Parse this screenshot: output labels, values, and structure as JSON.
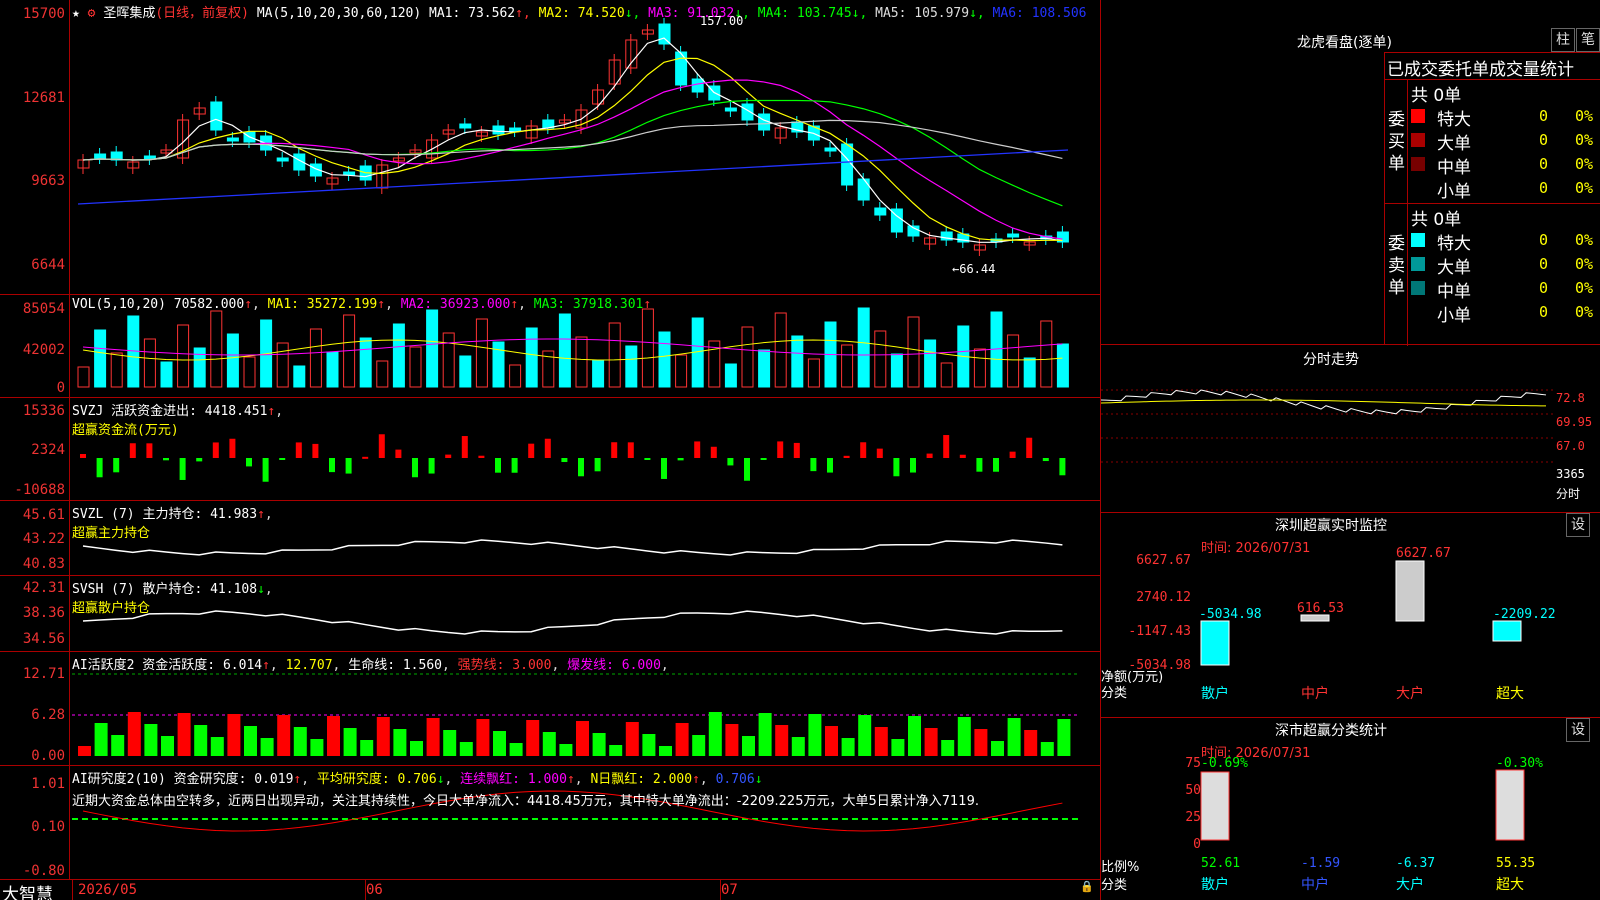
{
  "kline": {
    "stock_name": "圣晖集成",
    "period": "(日线，前复权)",
    "ma_label": "MA(5,10,20,30,60,120)",
    "ma_values": [
      {
        "label": "MA1: 73.562",
        "arrow": "↑",
        "color": "#ffffff"
      },
      {
        "label": "MA2: 74.520",
        "arrow": "↓",
        "color": "#ffff00"
      },
      {
        "label": "MA3: 91.032",
        "arrow": "↓",
        "color": "#ff00ff"
      },
      {
        "label": "MA4: 103.745",
        "arrow": "↓",
        "color": "#00ff00"
      },
      {
        "label": "MA5: 105.979",
        "arrow": "↓",
        "color": "#dddddd"
      },
      {
        "label": "MA6: 108.506",
        "arrow": "",
        "color": "#2233ff"
      }
    ],
    "y_ticks": [
      "15700",
      "12681",
      "9663",
      "6644"
    ],
    "high_marker": "157.00",
    "low_marker": "←66.44"
  },
  "vol": {
    "title": "VOL(5,10,20) 70582.000",
    "ma1": "MA1: 35272.199",
    "ma2": "MA2: 36923.000",
    "ma3": "MA3: 37918.301",
    "y_ticks": [
      "85054",
      "42002",
      "0"
    ]
  },
  "svzj": {
    "title": "SVZJ  活跃资金进出: 4418.451",
    "subtitle": "超赢资金流(万元)",
    "y_ticks": [
      "15336",
      "2324",
      "-10688"
    ]
  },
  "svzl": {
    "title": "SVZL (7) 主力持仓: 41.983",
    "subtitle": "超赢主力持仓",
    "y_ticks": [
      "45.61",
      "43.22",
      "40.83"
    ]
  },
  "svsh": {
    "title": "SVSH (7) 散户持仓: 41.108",
    "subtitle": "超赢散户持仓",
    "y_ticks": [
      "42.31",
      "38.36",
      "34.56"
    ]
  },
  "ai_active": {
    "title": "AI活跃度2 资金活跃度: 6.014",
    "v2": "12.707",
    "v3": "生命线: 1.560",
    "v4": "强势线: 3.000",
    "v5": "爆发线: 6.000",
    "y_ticks": [
      "12.71",
      "6.28",
      "0.00"
    ]
  },
  "ai_research": {
    "title": "AI研究度2(10) 资金研究度: 0.019",
    "v2": "平均研究度: 0.706",
    "v3": "连续飘红: 1.000",
    "v4": "N日飘红: 2.000",
    "v5": "0.706",
    "comment": "近期大资金总体由空转多，近两日出现异动，关注其持续性，今日大单净流入：4418.45万元，其中特大单净流出：-2209.225万元，大单5日累计净入7119.",
    "y_ticks": [
      "1.01",
      "0.10",
      "-0.80"
    ]
  },
  "xaxis": {
    "brand": "大智慧",
    "labels": [
      "2026/05",
      "06",
      "07"
    ]
  },
  "lhb": {
    "title": "龙虎看盘(逐单)",
    "btn1": "柱",
    "btn2": "笔",
    "header": "已成交委托单成交量统计",
    "buy_label": "委买单",
    "sell_label": "委卖单",
    "buy_total": "共 0单",
    "sell_total": "共 0单",
    "buy_rows": [
      {
        "name": "特大",
        "count": "0",
        "pct": "0%",
        "color": "#ff0000"
      },
      {
        "name": "大单",
        "count": "0",
        "pct": "0%",
        "color": "#aa0000"
      },
      {
        "name": "中单",
        "count": "0",
        "pct": "0%",
        "color": "#770000"
      },
      {
        "name": "小单",
        "count": "0",
        "pct": "0%",
        "color": ""
      }
    ],
    "sell_rows": [
      {
        "name": "特大",
        "count": "0",
        "pct": "0%",
        "color": "#00ffff"
      },
      {
        "name": "大单",
        "count": "0",
        "pct": "0%",
        "color": "#009999"
      },
      {
        "name": "中单",
        "count": "0",
        "pct": "0%",
        "color": "#007777"
      },
      {
        "name": "小单",
        "count": "0",
        "pct": "0%",
        "color": ""
      }
    ]
  },
  "intraday": {
    "title": "分时走势",
    "y_ticks": [
      "72.8",
      "69.95",
      "67.0",
      "3365"
    ],
    "vol_label": "分时"
  },
  "sz_monitor": {
    "title": "深圳超赢实时监控",
    "btn": "设",
    "time": "时间: 2026/07/31",
    "y_ticks": [
      "6627.67",
      "2740.12",
      "-1147.43",
      "-5034.98"
    ],
    "net_label": "净额(万元)",
    "cat_label": "分类",
    "categories": [
      "散户",
      "中户",
      "大户",
      "超大"
    ],
    "bar_labels": [
      "-5034.98",
      "616.53",
      "6627.67",
      "-2209.22"
    ]
  },
  "sz_stats": {
    "title": "深市超赢分类统计",
    "btn": "设",
    "time": "时间: 2026/07/31",
    "y_ticks": [
      "75",
      "50",
      "25",
      "0"
    ],
    "ratio_label": "比例%",
    "cat_label": "分类",
    "categories": [
      "散户",
      "中户",
      "大户",
      "超大"
    ],
    "top_labels": [
      "-0.69%",
      "-0.30%"
    ],
    "bottom_labels": [
      "52.61",
      "-1.59",
      "-6.37",
      "55.35"
    ]
  }
}
